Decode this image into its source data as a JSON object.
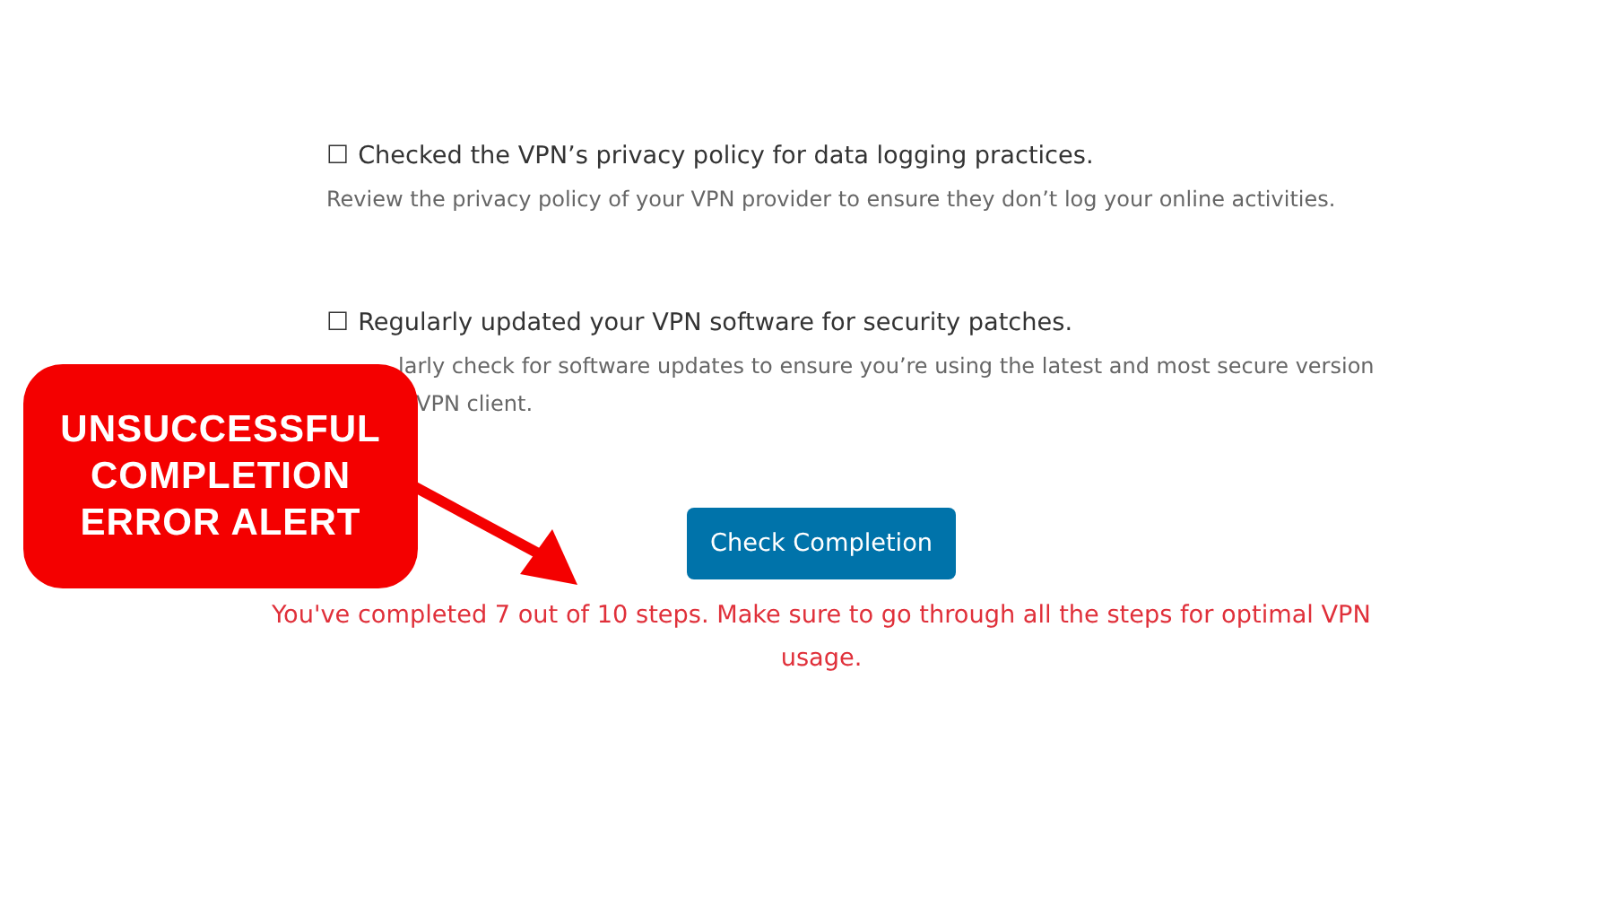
{
  "checklist": [
    {
      "checkbox": "☐",
      "checked": false,
      "title": "Checked the VPN’s privacy policy for data logging practices.",
      "description": [
        "Review the privacy policy of your VPN provider to ensure they don’t log your online activities."
      ]
    },
    {
      "checkbox": "☐",
      "checked": false,
      "title": "Regularly updated your VPN software for security patches.",
      "description": [
        "larly check for software updates to ensure you’re using the latest and most secure version",
        "VPN client."
      ]
    }
  ],
  "button": {
    "label": "Check Completion"
  },
  "result_message": "You've completed 7 out of 10 steps. Make sure to go through all the steps for optimal VPN usage.",
  "callout": {
    "text": "UNSUCCESSFUL COMPLETION ERROR ALERT"
  }
}
